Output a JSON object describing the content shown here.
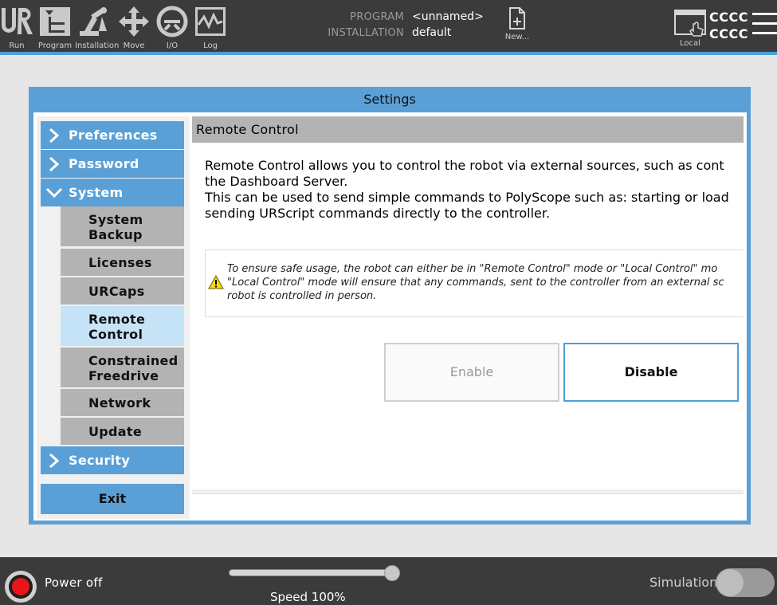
{
  "topbar": {
    "nav": [
      {
        "id": "run",
        "label": "Run",
        "icon": "ur-logo-icon"
      },
      {
        "id": "program",
        "label": "Program",
        "icon": "program-tree-icon"
      },
      {
        "id": "installation",
        "label": "Installation",
        "icon": "robot-arm-icon"
      },
      {
        "id": "move",
        "label": "Move",
        "icon": "move-arrows-icon"
      },
      {
        "id": "io",
        "label": "I/O",
        "icon": "io-icon"
      },
      {
        "id": "log",
        "label": "Log",
        "icon": "log-chart-icon"
      }
    ],
    "program_label": "PROGRAM",
    "program_value": "<unnamed>",
    "installation_label": "INSTALLATION",
    "installation_value": "default",
    "new_label": "New...",
    "local_label": "Local",
    "cccc_line1": "CCCC",
    "cccc_line2": "CCCC",
    "accent_color": "#4c9fd8"
  },
  "dialog": {
    "title": "Settings",
    "sidebar": {
      "preferences": "Preferences",
      "password": "Password",
      "system": "System",
      "sub_items": [
        {
          "line1": "System",
          "line2": "Backup"
        },
        {
          "line1": "Licenses",
          "line2": ""
        },
        {
          "line1": "URCaps",
          "line2": ""
        },
        {
          "line1": "Remote",
          "line2": "Control"
        },
        {
          "line1": "Constrained",
          "line2": "Freedrive"
        },
        {
          "line1": "Network",
          "line2": ""
        },
        {
          "line1": "Update",
          "line2": ""
        }
      ],
      "security": "Security",
      "exit": "Exit"
    },
    "panel": {
      "title": "Remote Control",
      "desc_lines": [
        "Remote Control allows you to control the robot via external sources, such as cont",
        "the Dashboard Server.",
        "This can be used to send simple commands to PolyScope such as: starting or load",
        "sending URScript commands directly to the controller."
      ],
      "warning_lines": [
        "To ensure safe usage, the robot can either be in \"Remote Control\" mode or \"Local Control\" mo",
        "\"Local Control\" mode will ensure that any commands, sent to the controller from an external sc",
        "robot is controlled in person."
      ],
      "enable_label": "Enable",
      "disable_label": "Disable"
    }
  },
  "bottombar": {
    "power_label": "Power off",
    "speed_label": "Speed 100%",
    "speed_fraction": 1.0,
    "simulation_label": "Simulation"
  }
}
